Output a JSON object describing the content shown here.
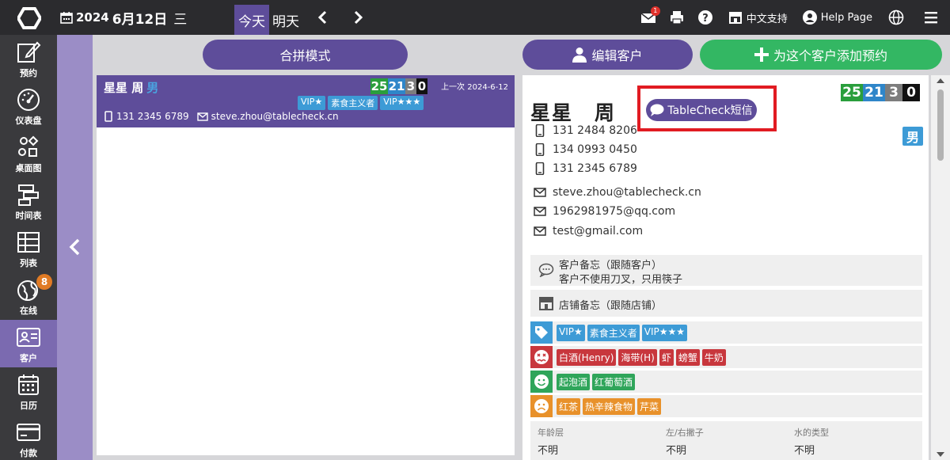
{
  "topbar": {
    "year": "2024",
    "date": "6月12日",
    "weekday": "三",
    "today": "今天",
    "tomorrow": "明天",
    "mail_badge": "1",
    "support": "中文支持",
    "help": "Help Page"
  },
  "nav": [
    {
      "label": "预约",
      "icon": "edit-icon"
    },
    {
      "label": "仪表盘",
      "icon": "gauge-icon"
    },
    {
      "label": "桌面图",
      "icon": "shapes-icon"
    },
    {
      "label": "时间表",
      "icon": "timeline-icon"
    },
    {
      "label": "列表",
      "icon": "table-icon"
    },
    {
      "label": "在线",
      "icon": "globe-icon",
      "badge": "8"
    },
    {
      "label": "客户",
      "icon": "id-card-icon"
    },
    {
      "label": "日历",
      "icon": "calendar-icon"
    },
    {
      "label": "付款",
      "icon": "credit-card-icon"
    }
  ],
  "merge_button": "合拼模式",
  "customer_card": {
    "surname": "星星 周",
    "gender": "男",
    "counts": [
      "25",
      "21",
      "3",
      "0"
    ],
    "last_visit": "上一次 2024-6-12",
    "tags": [
      "VIP★",
      "素食主义者",
      "VIP★★★"
    ],
    "phone": "131 2345 6789",
    "email": "steve.zhou@tablecheck.cn"
  },
  "detail": {
    "edit_button": "编辑客户",
    "add_button": "为这个客户添加预约",
    "name": "星星　周",
    "sms_button": "TableCheck短信",
    "gender": "男",
    "counts": [
      "25",
      "21",
      "3",
      "0"
    ],
    "phones": [
      "131 2484 8206",
      "134 0993 0450",
      "131 2345 6789"
    ],
    "emails": [
      "steve.zhou@tablecheck.cn",
      "1962981975@qq.com",
      "test@gmail.com"
    ],
    "customer_note_title": "客户备忘（跟随客户）",
    "customer_note_text": "客户不使用刀叉，只用筷子",
    "store_note_title": "店铺备忘（跟随店铺）",
    "tags": [
      "VIP★",
      "素食主义者",
      "VIP★★★"
    ],
    "allergies": [
      "白酒(Henry)",
      "海带(H)",
      "虾",
      "螃蟹",
      "牛奶"
    ],
    "likes": [
      "起泡酒",
      "红葡萄酒"
    ],
    "dislikes": [
      "红茶",
      "热辛辣食物",
      "芹菜"
    ],
    "attributes": [
      {
        "key": "年龄层",
        "value": "不明"
      },
      {
        "key": "左/右撇子",
        "value": "不明"
      },
      {
        "key": "水的类型",
        "value": "不明"
      }
    ]
  },
  "colors": {
    "topbar": "#2b2b2e",
    "purple": "#5e4d9a",
    "green": "#33b763",
    "tag_blue": "#3d9bd6",
    "allergy_red": "#c8373d",
    "like_green": "#2fa55a",
    "dislike_orange": "#e8912a",
    "highlight_red": "#e11b22"
  }
}
